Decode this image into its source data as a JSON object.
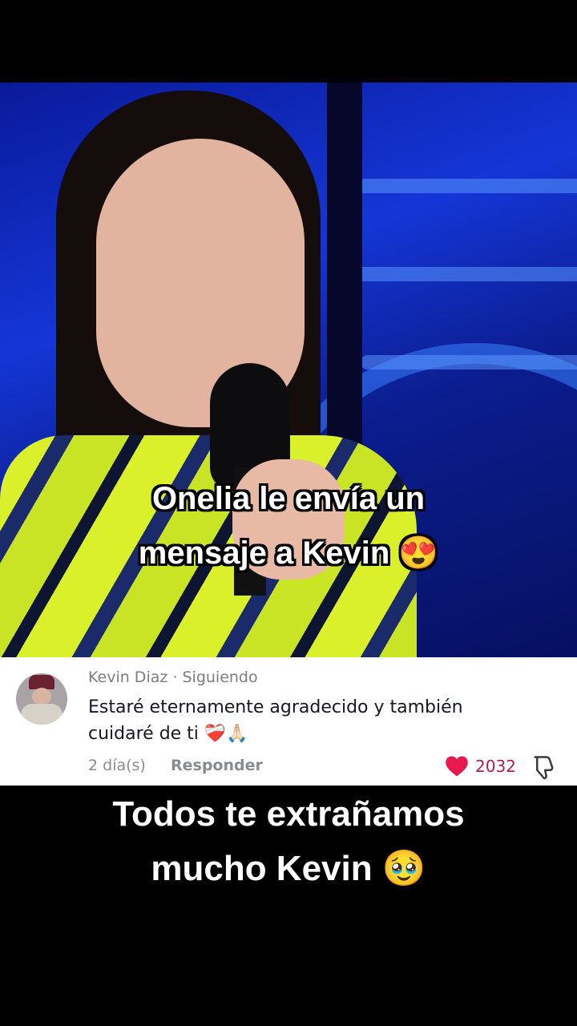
{
  "video": {
    "caption_line1": "Onelia le envía un",
    "caption_line2": "mensaje a Kevin 😍"
  },
  "comment": {
    "author": "Kevin Diaz",
    "separator": "·",
    "follow_status": "Siguiendo",
    "text_line1": "Estaré eternamente agradecido y también",
    "text_line2": "cuidaré de ti ❤️‍🩹🙏🏻",
    "date": "2 día(s)",
    "reply_label": "Responder",
    "likes": "2032",
    "like_color": "#e8194c"
  },
  "bottom_caption": {
    "line1": "Todos te extrañamos",
    "line2": "mucho Kevin 🥹"
  }
}
